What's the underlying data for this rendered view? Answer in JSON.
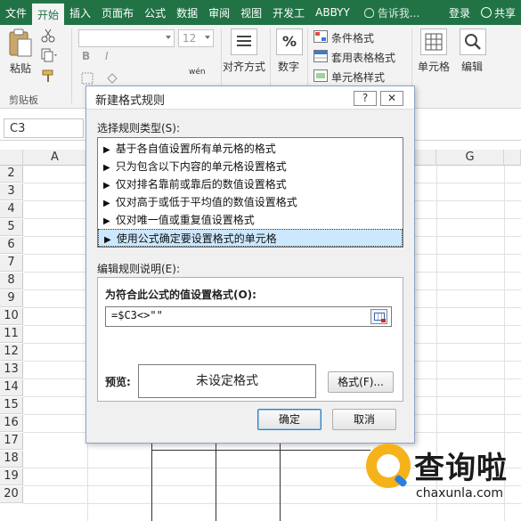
{
  "ribbon_tabs": [
    "文件",
    "开始",
    "插入",
    "页面布",
    "公式",
    "数据",
    "审阅",
    "视图",
    "开发工",
    "ABBYY"
  ],
  "tell_me": "告诉我...",
  "login": "登录",
  "share": "共享",
  "ribbon": {
    "paste": "粘贴",
    "clipboard_group": "剪贴板",
    "font_size": "12",
    "align": "对齐方式",
    "number": "数字",
    "percent": "%",
    "conditional_format": "条件格式",
    "table_format": "套用表格格式",
    "cell_style": "单元格样式",
    "cells": "单元格",
    "editing": "编辑",
    "wen": "wén"
  },
  "name_box": "C3",
  "columns": [
    "A",
    "G"
  ],
  "rows": [
    "2",
    "3",
    "4",
    "5",
    "6",
    "7",
    "8",
    "9",
    "10",
    "11",
    "12",
    "13",
    "14",
    "15",
    "16",
    "17",
    "18",
    "19",
    "20"
  ],
  "dialog": {
    "title": "新建格式规则",
    "help_button": "?",
    "close_button": "✕",
    "select_rule_type": "选择规则类型(S):",
    "rule_types": [
      "基于各自值设置所有单元格的格式",
      "只为包含以下内容的单元格设置格式",
      "仅对排名靠前或靠后的数值设置格式",
      "仅对高于或低于平均值的数值设置格式",
      "仅对唯一值或重复值设置格式",
      "使用公式确定要设置格式的单元格"
    ],
    "selected_rule_index": 5,
    "edit_rule_desc": "编辑规则说明(E):",
    "formula_label": "为符合此公式的值设置格式(O):",
    "formula_value": "=$C3<>\"\"",
    "preview_label": "预览:",
    "preview_text": "未设定格式",
    "format_button": "格式(F)...",
    "ok_button": "确定",
    "cancel_button": "取消"
  },
  "watermark": {
    "brand": "查询啦",
    "url": "chaxunla.com"
  },
  "colors": {
    "ribbon_green": "#217346",
    "selection_blue": "#cce8ff",
    "watermark_yellow": "#f6b21b",
    "watermark_blue": "#2a7fe0"
  }
}
